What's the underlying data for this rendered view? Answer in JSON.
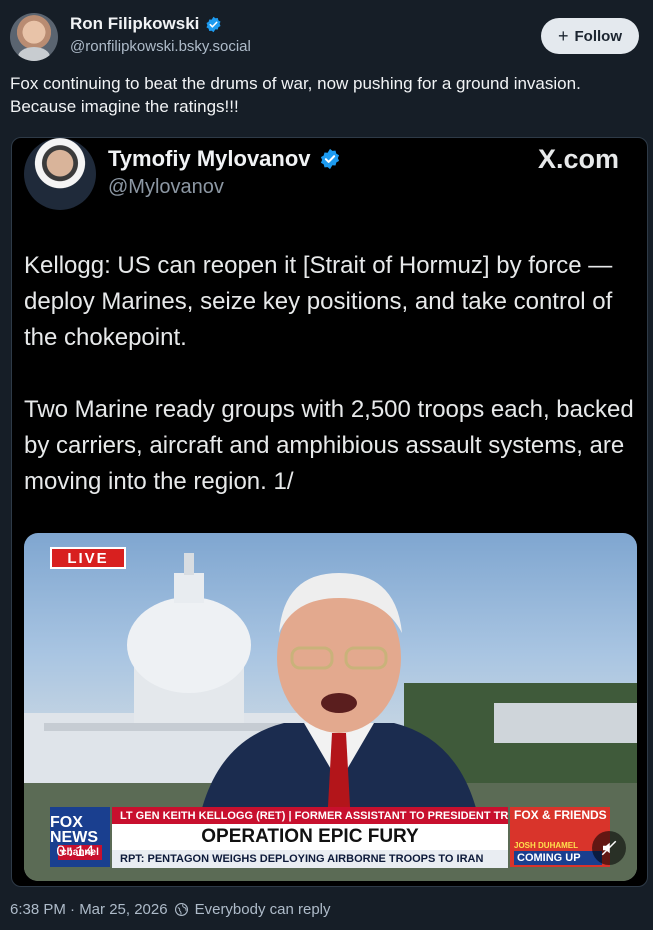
{
  "post": {
    "author_name": "Ron Filipkowski",
    "author_handle": "@ronfilipkowski.bsky.social",
    "follow_label": "Follow",
    "text": "Fox continuing to beat the drums of war, now pushing for a ground invasion. Because imagine the ratings!!!",
    "timestamp": "6:38 PM · Mar 25, 2026",
    "reply_setting": "Everybody can reply"
  },
  "embed": {
    "author_name": "Tymofiy Mylovanov",
    "author_handle": "@Mylovanov",
    "source": "X.com",
    "paragraphs": [
      "Kellogg: US can reopen it [Strait of Hormuz] by force — deploy Marines, seize key positions, and take control of the chokepoint.",
      "Two Marine ready groups with 2,500 troops each, backed by carriers, aircraft and amphibious assault systems, are moving into the region. 1/"
    ],
    "video": {
      "live_label": "LIVE",
      "chyron_top": "LT GEN KEITH KELLOGG (RET) | FORMER ASSISTANT TO PRESIDENT TRUMP",
      "chyron_headline": "OPERATION EPIC FURY",
      "chyron_sub": "RPT: PENTAGON WEIGHS DEPLOYING AIRBORNE TROOPS TO IRAN",
      "network_logo": "FOX NEWS",
      "network_logo_sub": "channel",
      "show_logo": "FOX & FRIENDS",
      "show_guest": "JOSH DUHAMEL",
      "show_coming": "COMING UP",
      "timecode": "0:14"
    }
  },
  "colors": {
    "background": "#161e27",
    "verified_badge": "#1d9bf0",
    "follow_bg": "#e4e9ee"
  }
}
